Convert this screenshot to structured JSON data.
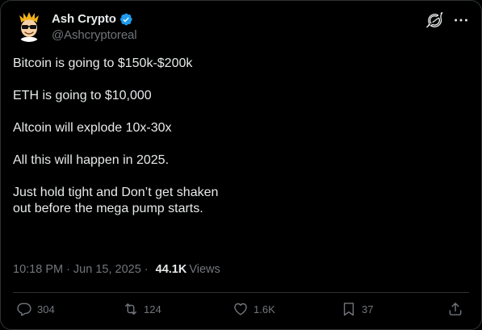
{
  "author": {
    "display_name": "Ash Crypto",
    "handle": "@Ashcryptoreal",
    "verified": true
  },
  "post": {
    "paragraphs": [
      "Bitcoin is going to $150k-$200k",
      "ETH is going to $10,000",
      "Altcoin will explode 10x-30x",
      "All this will happen in 2025.",
      "Just hold tight and Don’t get shaken\nout before the mega pump starts."
    ]
  },
  "meta": {
    "time": "10:18 PM",
    "separator": "·",
    "date": "Jun 15, 2025",
    "views_count": "44.1K",
    "views_label": "Views"
  },
  "actions": {
    "replies": "304",
    "reposts": "124",
    "likes": "1.6K",
    "bookmarks": "37"
  },
  "colors": {
    "background": "#000000",
    "text_primary": "#e7e9ea",
    "text_secondary": "#71767b",
    "verified_blue": "#1d9bf0",
    "border": "#2f3336"
  },
  "icons": {
    "verified": "verified-badge-icon",
    "grok": "grok-icon",
    "more": "more-icon",
    "reply": "reply-icon",
    "repost": "repost-icon",
    "like": "heart-icon",
    "bookmark": "bookmark-icon",
    "share": "share-icon"
  }
}
